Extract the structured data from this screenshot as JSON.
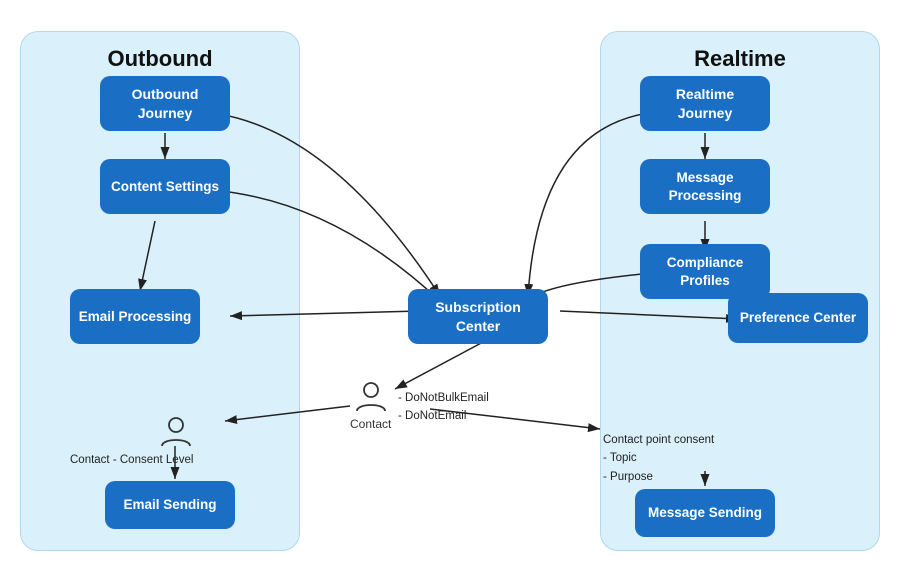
{
  "diagram": {
    "title_outbound": "Outbound",
    "title_realtime": "Realtime",
    "nodes": {
      "outbound_journey": "Outbound\nJourney",
      "content_settings": "Content\nSettings",
      "email_processing": "Email\nProcessing",
      "email_sending": "Email\nSending",
      "subscription_center": "Subscription\nCenter",
      "realtime_journey": "Realtime\nJourney",
      "message_processing": "Message\nProcessing",
      "compliance_profiles": "Compliance\nProfiles",
      "preference_center": "Preference\nCenter",
      "message_sending": "Message\nSending"
    },
    "contact_labels": {
      "main_contact": "Contact",
      "left_contact": "Contact",
      "consent_level": "Consent Level"
    },
    "list_items_contact": [
      "DoNotBulkEmail",
      "DoNotEmail"
    ],
    "list_items_right": [
      "Contact point consent",
      "Topic",
      "Purpose"
    ]
  }
}
